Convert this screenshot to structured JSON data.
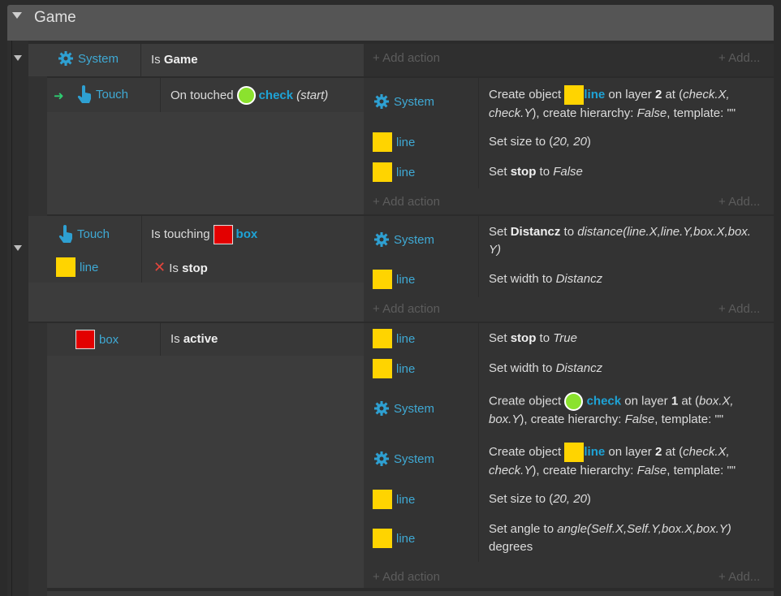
{
  "group": {
    "title": "Game"
  },
  "add_action": "+ Add action",
  "add_more": "+ Add...",
  "events": {
    "e1": {
      "cond": {
        "object": "System",
        "text_prefix": "Is",
        "text_bold": "Game"
      }
    },
    "e2": {
      "cond": {
        "object": "Touch",
        "text_prefix": "On touched",
        "ref": "check",
        "suffix": "(start)"
      },
      "actions": [
        {
          "object": "System",
          "t1": "Create object",
          "ref": "line",
          "t2": "on layer",
          "layer": "2",
          "t3": "at (",
          "arg1": "check.X,",
          "arg2": "check.Y",
          "t4": "), create hierarchy:",
          "hier": "False",
          "t5": ", template: \"\""
        },
        {
          "object": "line",
          "t1": "Set size to (",
          "val": "20, 20",
          "t2": ")"
        },
        {
          "object": "line",
          "t1": "Set",
          "bold": "stop",
          "t2": "to",
          "val": "False"
        }
      ]
    },
    "e3": {
      "conds": [
        {
          "object": "Touch",
          "text_prefix": "Is touching",
          "ref": "box"
        },
        {
          "object": "line",
          "invert": "✕",
          "text_prefix": "Is",
          "text_bold": "stop"
        }
      ],
      "actions": [
        {
          "object": "System",
          "t1": "Set",
          "bold": "Distancz",
          "t2": "to",
          "expr1": "distance(line.X,line.Y,box.X,box.",
          "expr2": "Y)"
        },
        {
          "object": "line",
          "t1": "Set width to",
          "val": "Distancz"
        }
      ]
    },
    "e4": {
      "cond": {
        "object": "box",
        "text_prefix": "Is",
        "text_bold": "active"
      },
      "actions": [
        {
          "object": "line",
          "t1": "Set",
          "bold": "stop",
          "t2": "to",
          "val": "True"
        },
        {
          "object": "line",
          "t1": "Set width to",
          "val": "Distancz"
        },
        {
          "object": "System",
          "t1": "Create object",
          "ref": "check",
          "t2": "on layer",
          "layer": "1",
          "t3": "at (",
          "arg1": "box.X,",
          "arg2": "box.Y",
          "t4": "), create hierarchy:",
          "hier": "False",
          "t5": ", template: \"\""
        },
        {
          "object": "System",
          "t1": "Create object",
          "ref": "line",
          "t2": "on layer",
          "layer": "2",
          "t3": "at (",
          "arg1": "check.X,",
          "arg2": "check.Y",
          "t4": "), create hierarchy:",
          "hier": "False",
          "t5": ", template: \"\""
        },
        {
          "object": "line",
          "t1": "Set size to (",
          "val": "20, 20",
          "t2": ")"
        },
        {
          "object": "line",
          "t1": "Set angle to",
          "expr": "angle(Self.X,Self.Y,box.X,box.Y)",
          "t2": "degrees"
        }
      ]
    }
  },
  "colors": {
    "accent": "#1ea3d6",
    "object_link": "#3fa9d4",
    "line_sprite": "#ffd400",
    "box_sprite": "#e30000",
    "check_sprite": "#8be22e"
  },
  "icons": {
    "system": "gear-icon",
    "touch": "hand-pointer-icon",
    "trigger": "arrow-right-icon",
    "invert": "x-icon"
  }
}
